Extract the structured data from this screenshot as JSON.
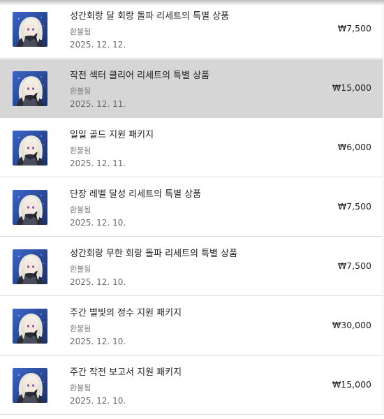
{
  "purchases": [
    {
      "title": "성간회랑 달 회랑 돌파 리세트의 특별 상품",
      "status": "환불됨",
      "date": "2025. 12. 12.",
      "price": "₩7,500",
      "selected": false
    },
    {
      "title": "작전 섹터 클리어 리세트의 특별 상품",
      "status": "환불됨",
      "date": "2025. 12. 11.",
      "price": "₩15,000",
      "selected": true
    },
    {
      "title": "일일 골드 지원 패키지",
      "status": "환불됨",
      "date": "2025. 12. 11.",
      "price": "₩6,000",
      "selected": false
    },
    {
      "title": "단장 레벨 달성 리세트의 특별 상품",
      "status": "환불됨",
      "date": "2025. 12. 10.",
      "price": "₩7,500",
      "selected": false
    },
    {
      "title": "성간회랑 무한 회랑 돌파 리세트의 특별 상품",
      "status": "환불됨",
      "date": "2025. 12. 10.",
      "price": "₩7,500",
      "selected": false
    },
    {
      "title": "주간 별빛의 정수 지원 패키지",
      "status": "환불됨",
      "date": "2025. 12. 10.",
      "price": "₩30,000",
      "selected": false
    },
    {
      "title": "주간 작전 보고서 지원 패키지",
      "status": "환불됨",
      "date": "2025. 12. 10.",
      "price": "₩15,000",
      "selected": false
    }
  ],
  "thumbnail_icon": "game-character-avatar",
  "colors": {
    "selected_row_bg": "#d6d6d6",
    "thumb_bg": "#2b4fa8",
    "divider": "#dcdcdc"
  }
}
